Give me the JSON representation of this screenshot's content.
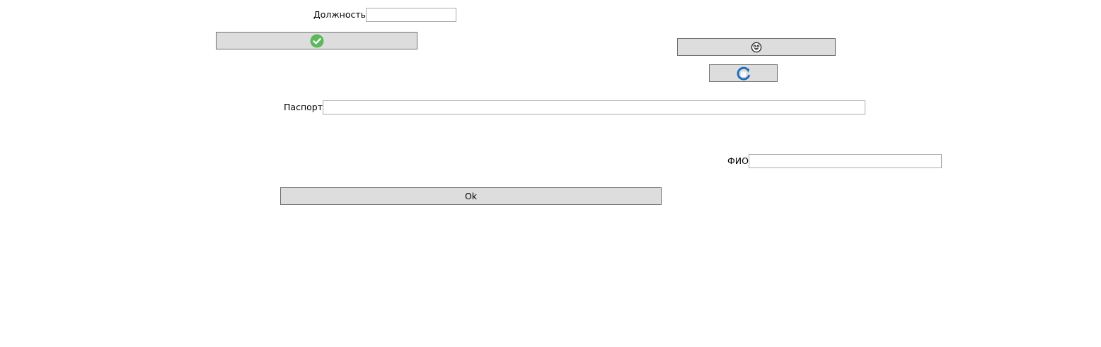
{
  "form": {
    "position_label": "Должность",
    "position_value": "",
    "passport_label": "Паспорт",
    "passport_value": "",
    "fio_label": "ФИО",
    "fio_value": "",
    "ok_label": "Ok"
  },
  "icons": {
    "confirm_button_icon": "check-circle-icon",
    "emoji_button_icon": "smiley-face-icon",
    "refresh_button_icon": "refresh-hand-icon"
  },
  "colors": {
    "check_green": "#5cb85c",
    "refresh_blue": "#1e6fc0",
    "button_face": "#dddddd",
    "button_border": "#707070",
    "field_border": "#ababab"
  }
}
